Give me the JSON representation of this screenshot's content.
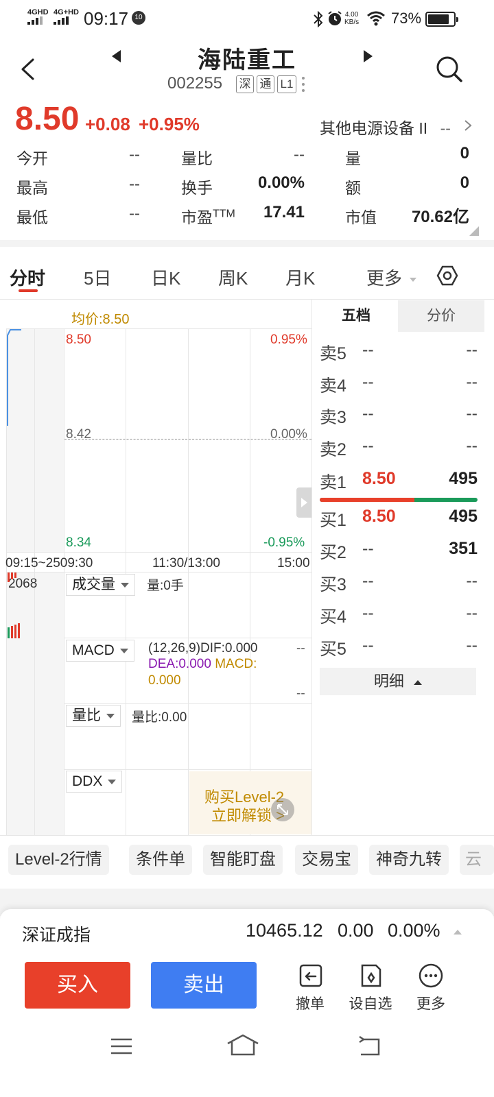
{
  "status_bar": {
    "sim1": "4GHD",
    "sim2": "4G+HD",
    "time": "09:17",
    "notif_badge": "10",
    "speed_value": "4.00",
    "speed_unit": "KB/s",
    "battery_pct": "73%",
    "icons": [
      "bluetooth-icon",
      "alarm-icon",
      "wifi-icon",
      "battery-icon"
    ]
  },
  "header": {
    "title": "海陆重工",
    "code": "002255",
    "tags": [
      "深",
      "通",
      "L1"
    ],
    "icons": [
      "back-icon",
      "prev-stock-icon",
      "next-stock-icon",
      "search-icon",
      "more-vertical-icon"
    ]
  },
  "quote": {
    "price": "8.50",
    "change": "+0.08",
    "change_pct": "+0.95%",
    "sector": "其他电源设备 II",
    "sector_value": "--",
    "stats": [
      {
        "label": "今开",
        "value": "--"
      },
      {
        "label": "量比",
        "value": "--"
      },
      {
        "label": "量",
        "value": "0"
      },
      {
        "label": "最高",
        "value": "--"
      },
      {
        "label": "换手",
        "value": "0.00%"
      },
      {
        "label": "额",
        "value": "0"
      },
      {
        "label": "最低",
        "value": "--"
      },
      {
        "label": "市盈",
        "label_sup": "TTM",
        "value": "17.41"
      },
      {
        "label": "市值",
        "value": "70.62亿"
      }
    ]
  },
  "chart_tabs": {
    "items": [
      "分时",
      "5日",
      "日K",
      "周K",
      "月K",
      "更多"
    ],
    "active": "分时",
    "settings_icon": "hexagon-settings-icon"
  },
  "chart": {
    "avg_label": "均价:8.50",
    "y_left": [
      "8.50",
      "8.42",
      "8.34"
    ],
    "y_right": [
      "0.95%",
      "0.00%",
      "-0.95%"
    ],
    "x_labels": [
      "09:15~2509:30",
      "11:30/13:00",
      "15:00"
    ],
    "volume_max": "2068",
    "colors": {
      "up": "#e03a2a",
      "down": "#1a9a5a",
      "line": "#4a90e2"
    }
  },
  "indicators": {
    "volume": {
      "button": "成交量",
      "text": "量:0手"
    },
    "macd": {
      "button": "MACD",
      "params": "(12,26,9)",
      "dif": "DIF:0.000",
      "dea": "DEA:0.000",
      "macd": "MACD:",
      "macd_val": "0.000",
      "right_top": "--",
      "right_bottom": "--"
    },
    "ratio": {
      "button": "量比",
      "text": "量比:0.00"
    },
    "ddx": {
      "button": "DDX",
      "promo_line1": "购买Level-2",
      "promo_line2": "立即解锁 >"
    }
  },
  "order_book": {
    "tabs": [
      "五档",
      "分价"
    ],
    "active_tab": "五档",
    "sells": [
      {
        "label": "卖5",
        "price": "--",
        "vol": "--"
      },
      {
        "label": "卖4",
        "price": "--",
        "vol": "--"
      },
      {
        "label": "卖3",
        "price": "--",
        "vol": "--"
      },
      {
        "label": "卖2",
        "price": "--",
        "vol": "--"
      },
      {
        "label": "卖1",
        "price": "8.50",
        "vol": "495"
      }
    ],
    "buys": [
      {
        "label": "买1",
        "price": "8.50",
        "vol": "495"
      },
      {
        "label": "买2",
        "price": "--",
        "vol": "351"
      },
      {
        "label": "买3",
        "price": "--",
        "vol": "--"
      },
      {
        "label": "买4",
        "price": "--",
        "vol": "--"
      },
      {
        "label": "买5",
        "price": "--",
        "vol": "--"
      }
    ],
    "detail_button": "明细",
    "sell_ratio": 0.6
  },
  "feature_chips": [
    "Level-2行情",
    "条件单",
    "智能盯盘",
    "交易宝",
    "神奇九转",
    "云"
  ],
  "index_bar": {
    "name": "深证成指",
    "value": "10465.12",
    "change": "0.00",
    "change_pct": "0.00%"
  },
  "actions": {
    "buy": "买入",
    "sell": "卖出",
    "tools": [
      {
        "label": "撤单",
        "icon": "undo-order-icon"
      },
      {
        "label": "设自选",
        "icon": "add-favorite-icon"
      },
      {
        "label": "更多",
        "icon": "more-icon"
      }
    ]
  },
  "nav_bar": {
    "icons": [
      "menu-icon",
      "home-icon",
      "back-nav-icon"
    ]
  }
}
